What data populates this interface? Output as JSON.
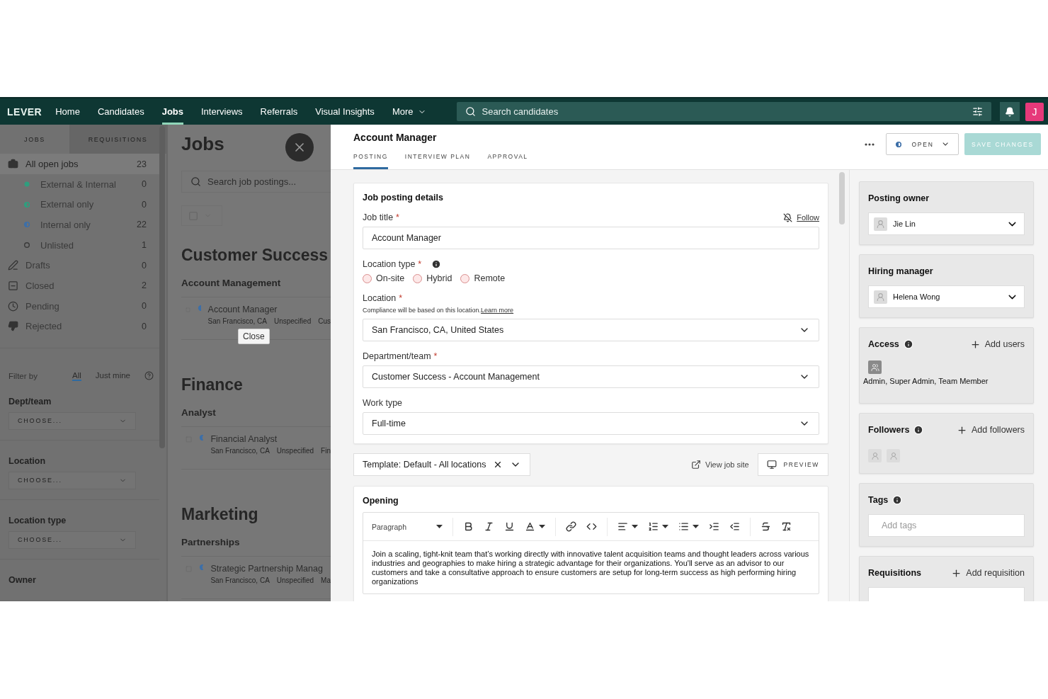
{
  "nav": {
    "logo": "LEVER",
    "items": [
      {
        "label": "Home",
        "selected": false,
        "kind": "link"
      },
      {
        "label": "Candidates",
        "selected": false,
        "kind": "link"
      },
      {
        "label": "Jobs",
        "selected": true,
        "kind": "link"
      },
      {
        "label": "Interviews",
        "selected": false,
        "kind": "link"
      },
      {
        "label": "Referrals",
        "selected": false,
        "kind": "link"
      },
      {
        "label": "Visual Insights",
        "selected": false,
        "kind": "link"
      },
      {
        "label": "More",
        "selected": false,
        "kind": "menu"
      }
    ],
    "search": {
      "placeholder": "Search candidates"
    },
    "avatar": "J"
  },
  "sidebar": {
    "tabs": [
      {
        "label": "JOBS",
        "selected": true
      },
      {
        "label": "REQUISITIONS",
        "selected": false
      }
    ],
    "items": [
      {
        "label": "All open jobs",
        "count": "23",
        "selected": true,
        "children": [
          {
            "label": "External & Internal",
            "count": "0",
            "kind": "full",
            "color": "#2f9e7e"
          },
          {
            "label": "External only",
            "count": "0",
            "kind": "half",
            "color": "#2f9e7e"
          },
          {
            "label": "Internal only",
            "count": "22",
            "kind": "half",
            "color": "#3d6fa8"
          },
          {
            "label": "Unlisted",
            "count": "1",
            "kind": "hollow",
            "color": "#3a3a3a"
          }
        ]
      },
      {
        "label": "Drafts",
        "count": "0",
        "selected": false
      },
      {
        "label": "Closed",
        "count": "2",
        "selected": false
      },
      {
        "label": "Pending",
        "count": "0",
        "selected": false
      },
      {
        "label": "Rejected",
        "count": "0",
        "selected": false
      }
    ],
    "filter": {
      "label": "Filter by",
      "options": [
        {
          "label": "All",
          "selected": true
        },
        {
          "label": "Just mine",
          "selected": false
        }
      ]
    },
    "filters": [
      {
        "label": "Dept/team",
        "placeholder": "CHOOSE..."
      },
      {
        "label": "Location",
        "placeholder": "CHOOSE..."
      },
      {
        "label": "Location type",
        "placeholder": "CHOOSE..."
      },
      {
        "label": "Owner"
      }
    ]
  },
  "jobs": {
    "title": "Jobs",
    "search": {
      "placeholder": "Search job postings..."
    },
    "tooltip": "Close",
    "departments": [
      {
        "name": "Customer Success",
        "teams": [
          {
            "name": "Account Management",
            "postings": [
              {
                "title": "Account Manager",
                "checked": false,
                "meta": [
                  "San Francisco, CA",
                  "Unspecified",
                  "Cus"
                ]
              }
            ]
          }
        ]
      },
      {
        "name": "Finance",
        "teams": [
          {
            "name": "Analyst",
            "postings": [
              {
                "title": "Financial Analyst",
                "checked": false,
                "meta": [
                  "San Francisco, CA",
                  "Unspecified",
                  "Fin"
                ]
              }
            ]
          }
        ]
      },
      {
        "name": "Marketing",
        "teams": [
          {
            "name": "Partnerships",
            "postings": [
              {
                "title": "Strategic Partnership Manag",
                "checked": false,
                "meta": [
                  "San Francisco, CA",
                  "Unspecified",
                  "Ma"
                ]
              }
            ]
          }
        ]
      }
    ]
  },
  "editor": {
    "title": "Account Manager",
    "tabs": [
      {
        "label": "POSTING",
        "selected": true
      },
      {
        "label": "INTERVIEW PLAN",
        "selected": false
      },
      {
        "label": "APPROVAL",
        "selected": false
      }
    ],
    "status": "OPEN",
    "save": {
      "label": "SAVE CHANGES",
      "disabled": true
    },
    "details": {
      "heading": "Job posting details",
      "follow": "Follow",
      "fields": [
        {
          "kind": "text",
          "label": "Job title",
          "required_mark": "*",
          "value": "Account Manager"
        },
        {
          "kind": "radio",
          "label": "Location type",
          "required_mark": "*",
          "info": true,
          "options": [
            {
              "label": "On-site",
              "selected": false
            },
            {
              "label": "Hybrid",
              "selected": false
            },
            {
              "label": "Remote",
              "selected": false
            }
          ]
        },
        {
          "kind": "select",
          "label": "Location",
          "required_mark": "*",
          "note": "Compliance will be based on this location.",
          "note_link": "Learn more",
          "value": "San Francisco, CA, United States"
        },
        {
          "kind": "select",
          "label": "Department/team",
          "required_mark": "*",
          "value": "Customer Success - Account Management"
        },
        {
          "kind": "select",
          "label": "Work type",
          "value": "Full-time"
        }
      ]
    },
    "template": {
      "label": "Template: Default - All locations",
      "view_site": "View job site",
      "preview": "PREVIEW"
    },
    "opening": {
      "heading": "Opening",
      "block_style": "Paragraph",
      "text": "Join a scaling, tight-knit team that’s working directly with innovative talent acquisition teams and thought leaders across various industries and geographies to make hiring a strategic advantage for their organizations. You'll serve as an advisor to our customers and take a consultative approach to ensure customers are setup for long-term success as high performing hiring organizations"
    }
  },
  "side_cards": [
    {
      "kind": "person",
      "label": "Posting owner",
      "value": "Jie Lin"
    },
    {
      "kind": "person",
      "label": "Hiring manager",
      "value": "Helena Wong"
    },
    {
      "kind": "access",
      "label": "Access",
      "info": true,
      "action": "Add users",
      "text": "Admin, Super Admin, Team Member"
    },
    {
      "kind": "followers",
      "label": "Followers",
      "info": true,
      "action": "Add followers"
    },
    {
      "kind": "tags",
      "label": "Tags",
      "info": true,
      "placeholder": "Add tags"
    },
    {
      "kind": "requisitions",
      "label": "Requisitions",
      "action": "Add requisition"
    }
  ]
}
